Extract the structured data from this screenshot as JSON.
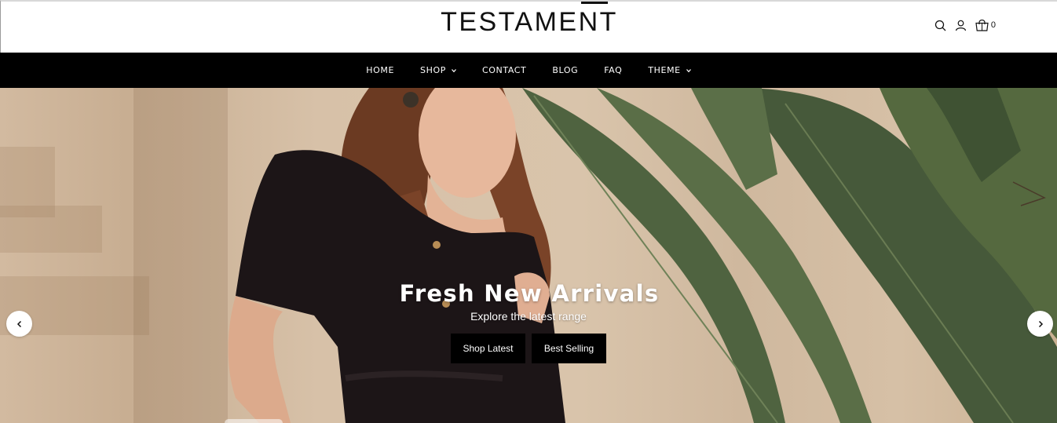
{
  "brand": {
    "logo_text": "TESTAMENT"
  },
  "header": {
    "icons": [
      "search-icon",
      "account-icon",
      "cart-icon"
    ],
    "cart_count": "0"
  },
  "nav": {
    "items": [
      {
        "label": "HOME",
        "has_dropdown": false
      },
      {
        "label": "SHOP",
        "has_dropdown": true
      },
      {
        "label": "CONTACT",
        "has_dropdown": false
      },
      {
        "label": "BLOG",
        "has_dropdown": false
      },
      {
        "label": "FAQ",
        "has_dropdown": false
      },
      {
        "label": "THEME",
        "has_dropdown": true
      }
    ]
  },
  "hero": {
    "title": "Fresh New Arrivals",
    "subtitle": "Explore the latest range",
    "buttons": {
      "primary": "Shop Latest",
      "secondary": "Best Selling"
    },
    "controls": [
      "chevron-left-icon",
      "chevron-right-icon"
    ]
  },
  "colors": {
    "nav_bg": "#000000",
    "button_bg": "#000000",
    "text_light": "#ffffff",
    "leaf_green": "#4f6340",
    "dress": "#1c1517",
    "wall": "#d7c1a8"
  }
}
